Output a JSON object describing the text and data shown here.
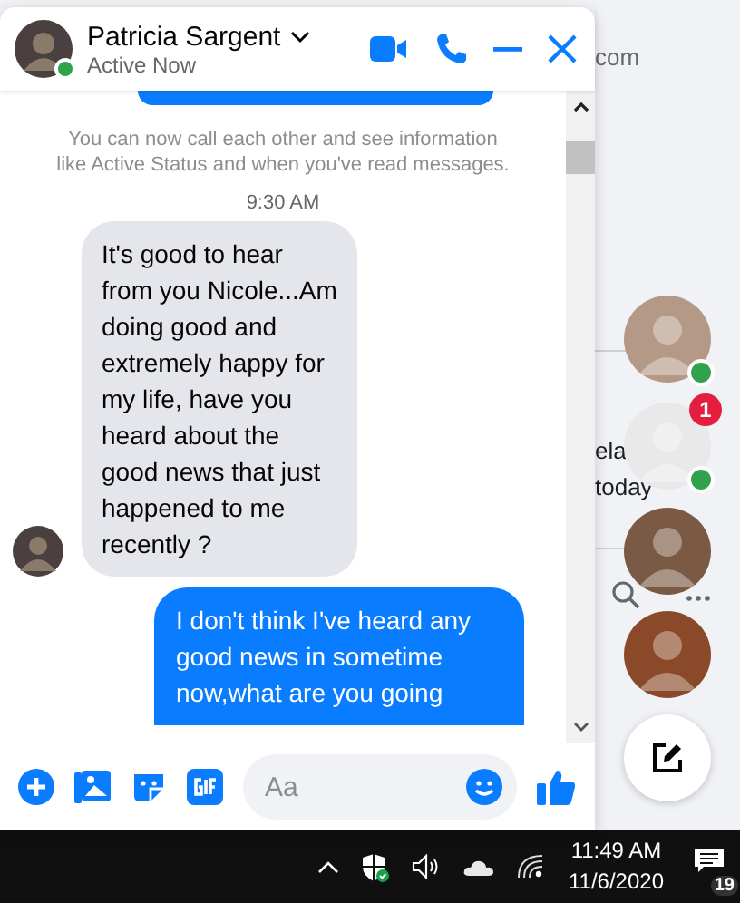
{
  "background_texts": [
    {
      "text": "com"
    },
    {
      "text": "ela"
    },
    {
      "text": "today"
    }
  ],
  "chat": {
    "contact": {
      "name": "Patricia Sargent",
      "status": "Active Now",
      "online": true
    },
    "notice": "You can now call each other and see information like Active Status and when you've read messages.",
    "time": "9:30 AM",
    "messages": [
      {
        "kind": "received",
        "text": "It's good to hear from you Nicole...Am doing good and extremely happy for my life, have you heard about the good news that just happened to me recently ?"
      },
      {
        "kind": "sent",
        "text": "I don't think I've heard any good news in sometime now,what are you going"
      }
    ],
    "composer": {
      "placeholder": "Aa"
    }
  },
  "chat_heads": [
    {
      "online": true,
      "color": "#b49a86"
    },
    {
      "online": true,
      "badge": "1",
      "color": "#e9e9e9"
    },
    {
      "online": false,
      "color": "#7a5a44"
    },
    {
      "online": false,
      "color": "#8a4a2a"
    }
  ],
  "taskbar": {
    "time": "11:49 AM",
    "date": "11/6/2020",
    "notifications": "19"
  }
}
